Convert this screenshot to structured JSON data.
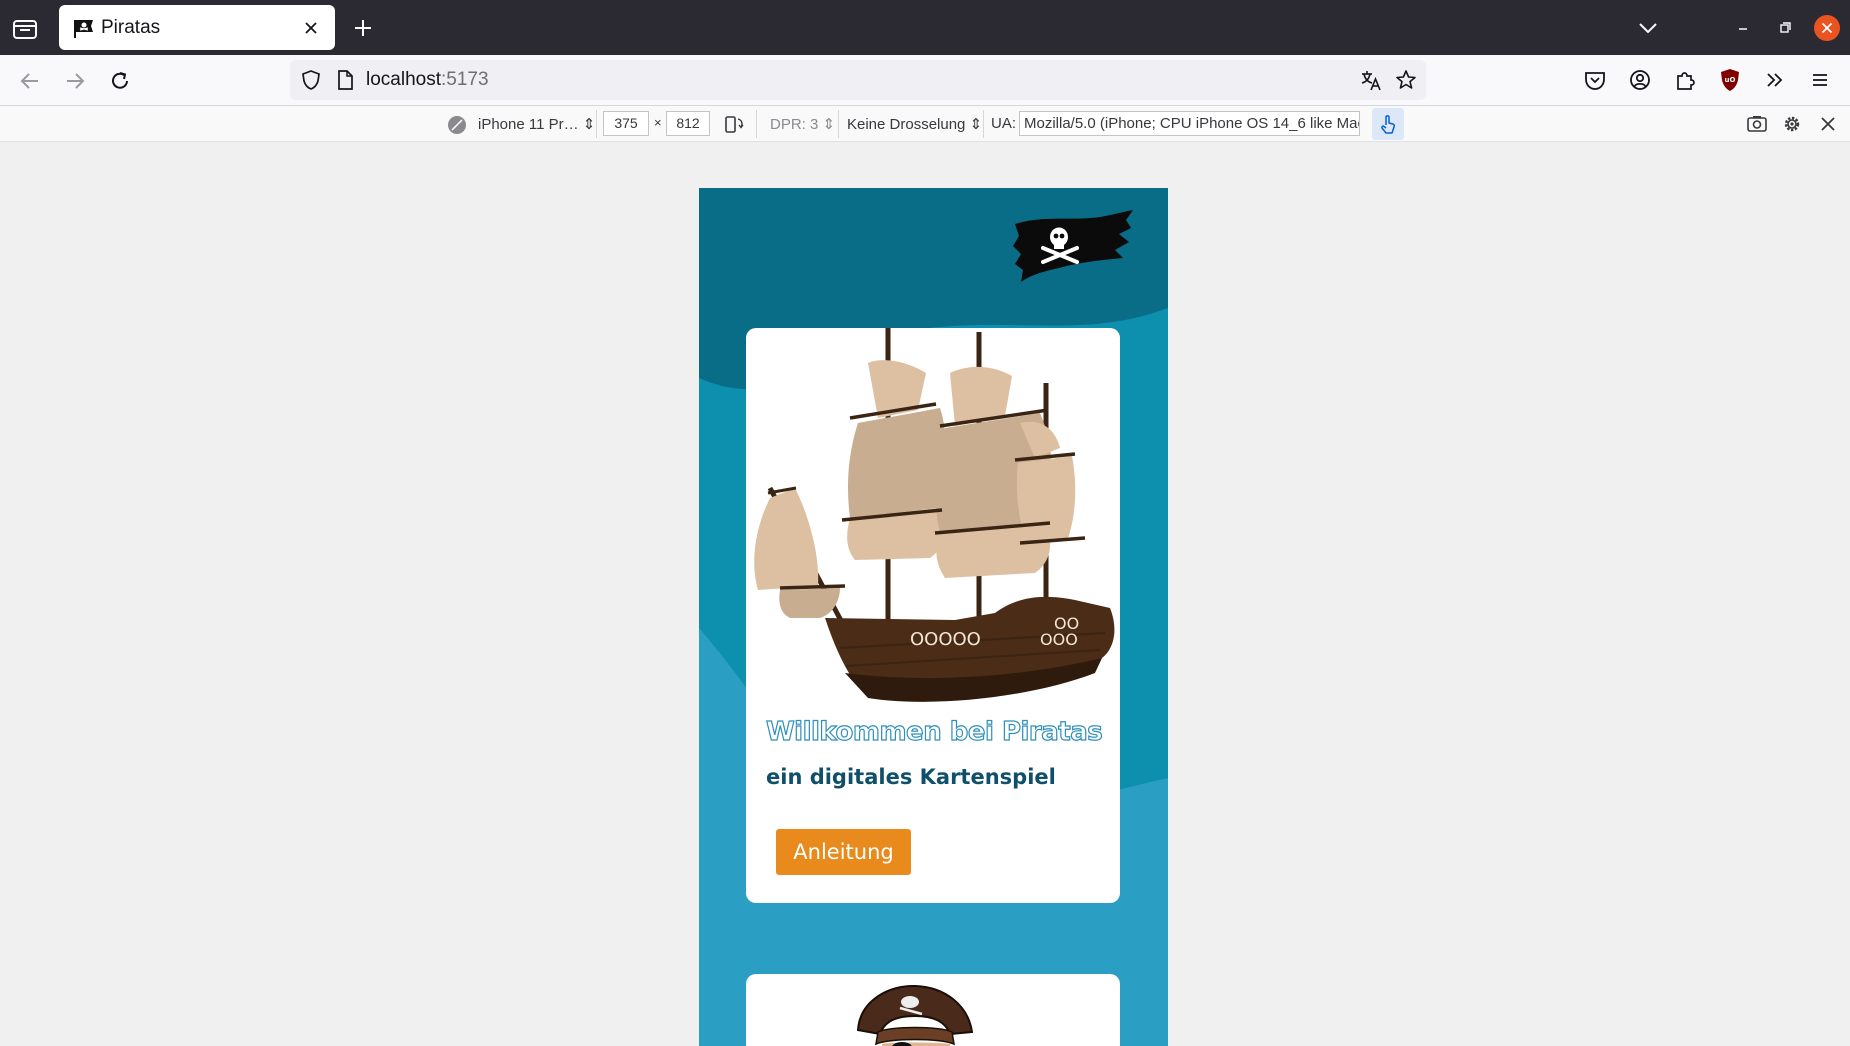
{
  "browser": {
    "tab": {
      "title": "Piratas"
    },
    "url": {
      "host": "localhost",
      "port": ":5173"
    }
  },
  "responsive_toolbar": {
    "device": "iPhone 11 Pr…",
    "width": "375",
    "times": "×",
    "height": "812",
    "dpr": "DPR: 3",
    "throttling": "Keine Drosselung",
    "ua_label": "UA:",
    "ua_value": "Mozilla/5.0 (iPhone; CPU iPhone OS 14_6 like Mac"
  },
  "page": {
    "card": {
      "title": "Willkommen bei Piratas",
      "subtitle": "ein digitales Kartenspiel",
      "button_label": "Anleitung"
    },
    "ship_porthole_labels": [
      "OOOOO",
      "OOO",
      "OO"
    ]
  },
  "colors": {
    "tabbar": "#2b2a33",
    "page_bg_dark": "#0a6d87",
    "page_bg_light": "#2b9fc3",
    "card_title_outline": "#2e8fbb",
    "subtitle": "#0f4f6a",
    "button": "#e98a1c"
  },
  "icons": [
    "tab-list-icon",
    "pirate-flag-favicon",
    "close-icon",
    "plus-icon",
    "chevron-down-icon",
    "minimize-icon",
    "maximize-icon",
    "window-close-icon",
    "back-arrow-icon",
    "forward-arrow-icon",
    "reload-icon",
    "shield-icon",
    "page-icon",
    "translate-icon",
    "star-icon",
    "pocket-icon",
    "account-icon",
    "extensions-icon",
    "ublock-icon",
    "overflow-icon",
    "menu-icon",
    "device-icon",
    "rotate-icon",
    "touch-icon",
    "screenshot-icon",
    "settings-icon",
    "close-icon"
  ]
}
